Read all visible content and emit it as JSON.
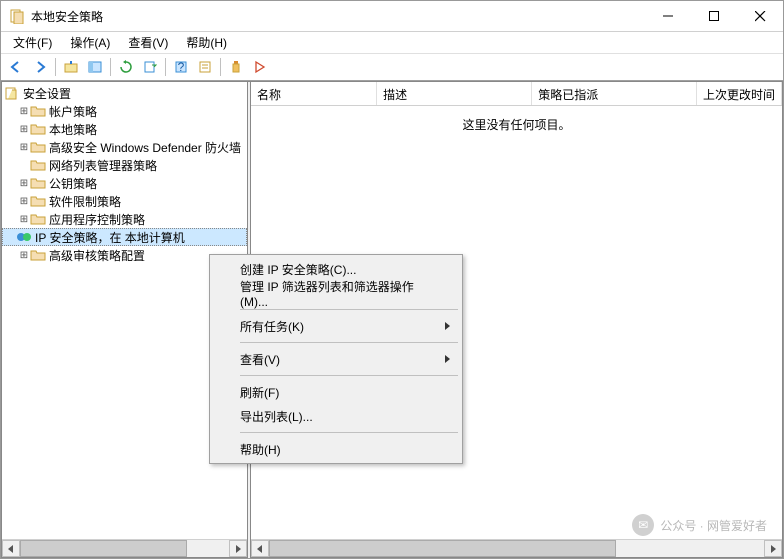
{
  "window": {
    "title": "本地安全策略"
  },
  "menu": {
    "file": "文件(F)",
    "action": "操作(A)",
    "view": "查看(V)",
    "help": "帮助(H)"
  },
  "tree": {
    "root": "安全设置",
    "items": [
      "帐户策略",
      "本地策略",
      "高级安全 Windows Defender 防火墙",
      "网络列表管理器策略",
      "公钥策略",
      "软件限制策略",
      "应用程序控制策略",
      "IP 安全策略，在 本地计算机",
      "高级审核策略配置"
    ]
  },
  "columns": {
    "name": "名称",
    "desc": "描述",
    "assigned": "策略已指派",
    "lastmod": "上次更改时间"
  },
  "empty": "这里没有任何项目。",
  "ctx": {
    "create": "创建 IP 安全策略(C)...",
    "manage": "管理 IP 筛选器列表和筛选器操作(M)...",
    "alltasks": "所有任务(K)",
    "view": "查看(V)",
    "refresh": "刷新(F)",
    "export": "导出列表(L)...",
    "help": "帮助(H)"
  },
  "watermark": "公众号 · 网管爱好者"
}
